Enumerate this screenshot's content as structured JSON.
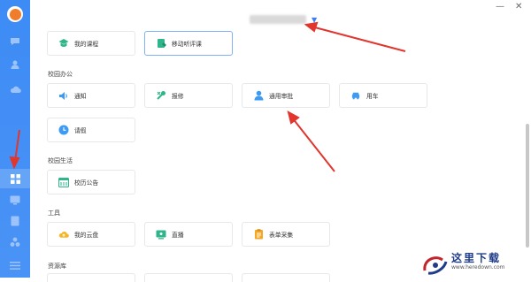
{
  "window": {
    "minimize_label": "—",
    "close_label": "✕"
  },
  "sections": [
    {
      "title": ""
    },
    {
      "title": "校园办公"
    },
    {
      "title": "校园生活"
    },
    {
      "title": "工具"
    },
    {
      "title": "资源库"
    }
  ],
  "tiles": {
    "my_course": "我的课程",
    "mobile_review": "移动听评课",
    "notice": "通知",
    "repair": "报修",
    "approval": "通用审批",
    "car": "用车",
    "leave": "请假",
    "calendar": "校历公告",
    "cloud": "我的云盘",
    "live": "直播",
    "form": "表单采集"
  },
  "colors": {
    "sidebar": "#3d8bf5",
    "accent": "#3d7ef6",
    "annotation_arrow": "#e0362d"
  },
  "icons": [
    "avatar",
    "chat-icon",
    "contacts-icon",
    "cloud-icon",
    "apps-grid-icon",
    "monitor-icon",
    "document-icon",
    "share-icon",
    "menu-icon"
  ],
  "watermark": {
    "text": "这里下载",
    "url": "www.heredown.com"
  }
}
